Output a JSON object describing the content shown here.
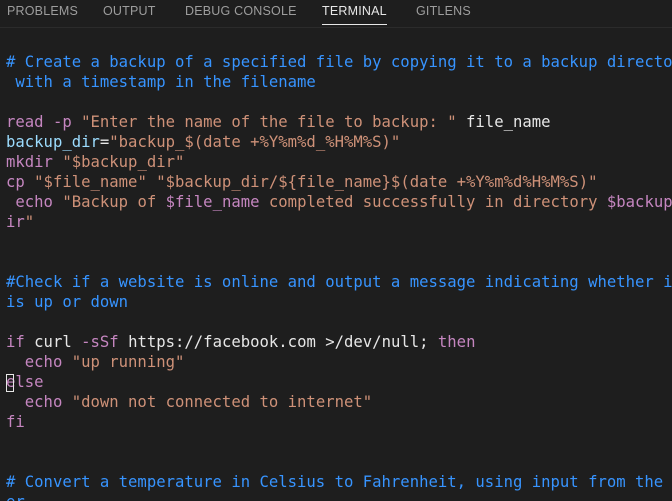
{
  "panel": {
    "tabs": [
      {
        "label": "PROBLEMS"
      },
      {
        "label": "OUTPUT"
      },
      {
        "label": "DEBUG CONSOLE"
      },
      {
        "label": "TERMINAL"
      },
      {
        "label": "GITLENS"
      }
    ],
    "active_tab": "TERMINAL"
  },
  "colors": {
    "background": "#1e1e1e",
    "comment": "#3794ff",
    "keyword": "#c586c0",
    "string": "#ce9178",
    "text": "#d4d4d4"
  },
  "terminal": {
    "l1": "# Create a backup of a specified file by copying it to a backup directory",
    "l2": " with a timestamp in the filename",
    "l4a": "read -p ",
    "l4b": "\"Enter the name of the file to backup: \"",
    "l4c": " file_name",
    "l5a": "backup_dir",
    "l5b": "=",
    "l5c": "\"backup_$(date +%Y%m%d_%H%M%S)\"",
    "l6a": "mkdir ",
    "l6b": "\"$backup_dir\"",
    "l7a": "cp ",
    "l7b": "\"$file_name\" \"$backup_dir/${file_name}$(date +%Y%m%d%H%M%S)\"",
    "l8a": " echo ",
    "l8b": "\"Backup of ",
    "l8c": "$file_name",
    "l8d": " completed successfully in directory ",
    "l8e": "$backup_d",
    "l9a": "ir",
    "l9b": "\"",
    "l12": "#Check if a website is online and output a message indicating whether it",
    "l13": "is up or down",
    "l15a": "if ",
    "l15b": "curl ",
    "l15c": "-sSf ",
    "l15d": "https://facebook.com ",
    "l15e": ">/dev/null; ",
    "l15f": "then",
    "l16a": "  echo ",
    "l16b": "\"up running\"",
    "l17": "else",
    "l18a": "  echo ",
    "l18b": "\"down not connected to internet\"",
    "l19": "fi",
    "l22": "# Convert a temperature in Celsius to Fahrenheit, using input from the us",
    "l23": "er"
  }
}
